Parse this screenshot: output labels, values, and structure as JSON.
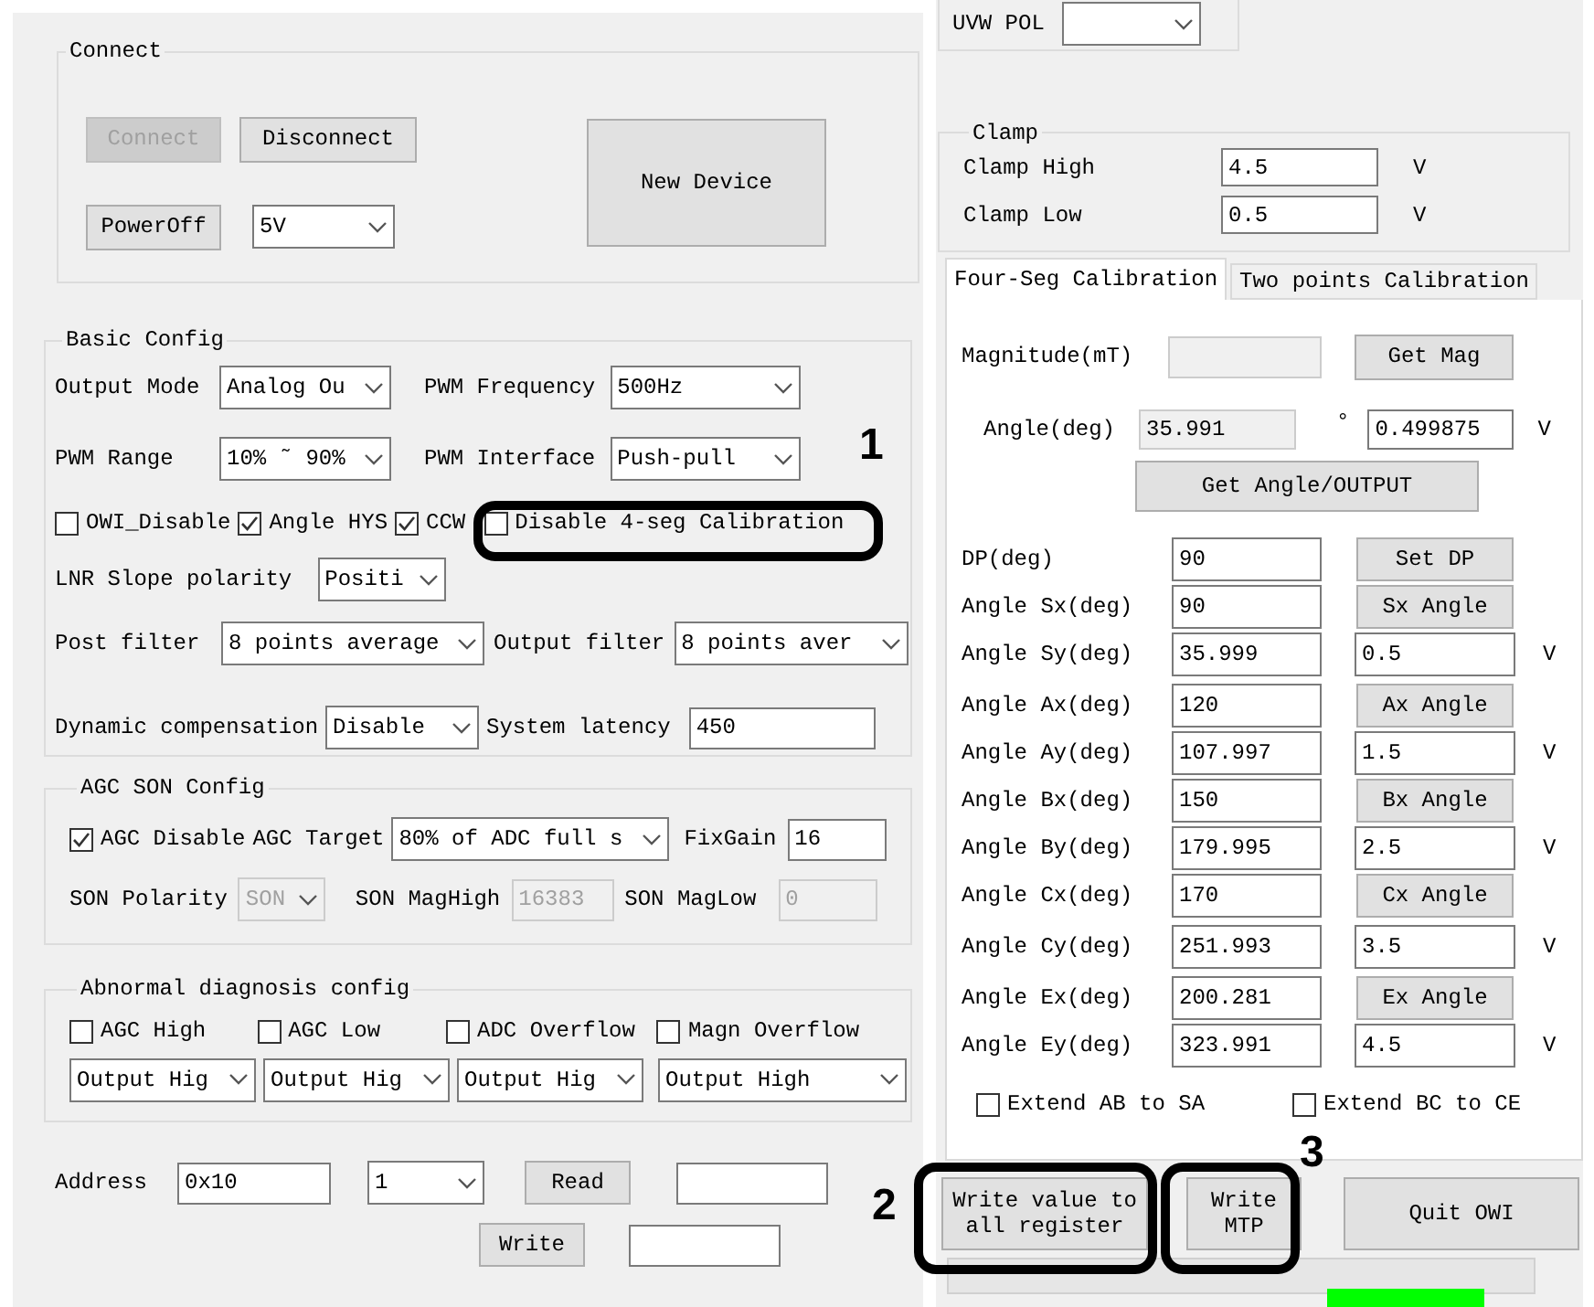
{
  "connect": {
    "title": "Connect",
    "buttons": [
      {
        "label": "Connect",
        "disabled": true
      },
      {
        "label": "Disconnect",
        "disabled": false
      }
    ],
    "power_button": "PowerOff",
    "voltage": "5V",
    "new_device": "New Device"
  },
  "basic_config": {
    "title": "Basic Config",
    "output_mode": {
      "label": "Output Mode",
      "value": "Analog Ou"
    },
    "pwm_frequency": {
      "label": "PWM Frequency",
      "value": "500Hz"
    },
    "pwm_range": {
      "label": "PWM Range",
      "value": "10% ˜ 90%"
    },
    "pwm_interface": {
      "label": "PWM Interface",
      "value": "Push-pull"
    },
    "checkboxes": [
      {
        "label": "OWI_Disable",
        "checked": false
      },
      {
        "label": "Angle HYS",
        "checked": true
      },
      {
        "label": "CCW",
        "checked": true
      },
      {
        "label": "Disable 4-seg Calibration",
        "checked": false
      }
    ],
    "lnr_slope": {
      "label": "LNR Slope polarity",
      "value": "Positi"
    },
    "post_filter": {
      "label": "Post filter",
      "value": "8 points average"
    },
    "output_filter": {
      "label": "Output filter",
      "value": "8 points aver"
    },
    "dynamic_compensation": {
      "label": "Dynamic compensation",
      "value": "Disable"
    },
    "system_latency": {
      "label": "System latency",
      "value": "450"
    }
  },
  "agc_son_config": {
    "title": "AGC SON Config",
    "agc_disable": {
      "label": "AGC Disable",
      "checked": true
    },
    "agc_target": {
      "label": "AGC Target",
      "value": "80% of ADC full s"
    },
    "fix_gain": {
      "label": "FixGain",
      "value": "16"
    },
    "son_polarity": {
      "label": "SON Polarity",
      "value": "SON",
      "disabled": true
    },
    "son_mag_high": {
      "label": "SON MagHigh",
      "value": "16383",
      "disabled": true
    },
    "son_mag_low": {
      "label": "SON MagLow",
      "value": "0",
      "disabled": true
    }
  },
  "abnormal_diagnosis": {
    "title": "Abnormal diagnosis config",
    "checkboxes": [
      {
        "label": "AGC High",
        "checked": false
      },
      {
        "label": "AGC Low",
        "checked": false
      },
      {
        "label": "ADC Overflow",
        "checked": false
      },
      {
        "label": "Magn Overflow",
        "checked": false
      }
    ],
    "outputs": [
      "Output Hig",
      "Output Hig",
      "Output Hig",
      "Output High"
    ]
  },
  "register": {
    "label": "Address",
    "address": "0x10",
    "count": "1",
    "read": "Read",
    "write": "Write"
  },
  "uvw": {
    "label": "UVW POL"
  },
  "clamp": {
    "title": "Clamp",
    "rows": [
      {
        "label": "Clamp High",
        "value": "4.5",
        "unit": "V"
      },
      {
        "label": "Clamp Low",
        "value": "0.5",
        "unit": "V"
      }
    ]
  },
  "calibration": {
    "tabs": [
      {
        "label": "Four-Seg Calibration",
        "selected": true
      },
      {
        "label": "Two points Calibration",
        "selected": false
      }
    ],
    "magnitude": {
      "label": "Magnitude(mT)",
      "button": "Get Mag"
    },
    "angle": {
      "label": "Angle(deg)",
      "value": "35.991",
      "degree": "°",
      "output": "0.499875",
      "unit": "V"
    },
    "get_angle": "Get Angle/OUTPUT",
    "points": [
      {
        "label": "DP(deg)",
        "value": "90",
        "kind": "button",
        "button": "Set DP"
      },
      {
        "label": "Angle Sx(deg)",
        "value": "90",
        "kind": "button",
        "button": "Sx Angle"
      },
      {
        "label": "Angle Sy(deg)",
        "value": "35.999",
        "kind": "output",
        "output": "0.5",
        "unit": "V"
      },
      {
        "label": "Angle Ax(deg)",
        "value": "120",
        "kind": "button",
        "button": "Ax Angle"
      },
      {
        "label": "Angle Ay(deg)",
        "value": "107.997",
        "kind": "output",
        "output": "1.5",
        "unit": "V"
      },
      {
        "label": "Angle Bx(deg)",
        "value": "150",
        "kind": "button",
        "button": "Bx Angle"
      },
      {
        "label": "Angle By(deg)",
        "value": "179.995",
        "kind": "output",
        "output": "2.5",
        "unit": "V"
      },
      {
        "label": "Angle Cx(deg)",
        "value": "170",
        "kind": "button",
        "button": "Cx Angle"
      },
      {
        "label": "Angle Cy(deg)",
        "value": "251.993",
        "kind": "output",
        "output": "3.5",
        "unit": "V"
      },
      {
        "label": "Angle Ex(deg)",
        "value": "200.281",
        "kind": "button",
        "button": "Ex Angle"
      },
      {
        "label": "Angle Ey(deg)",
        "value": "323.991",
        "kind": "output",
        "output": "4.5",
        "unit": "V"
      }
    ],
    "extend": [
      {
        "label": "Extend AB to SA",
        "checked": false
      },
      {
        "label": "Extend BC to CE",
        "checked": false
      }
    ]
  },
  "actions": [
    {
      "label": "Write value to all register"
    },
    {
      "label": "Write MTP"
    },
    {
      "label": "Quit OWI"
    }
  ],
  "annotations": [
    {
      "label": "1"
    },
    {
      "label": "2"
    },
    {
      "label": "3"
    }
  ]
}
